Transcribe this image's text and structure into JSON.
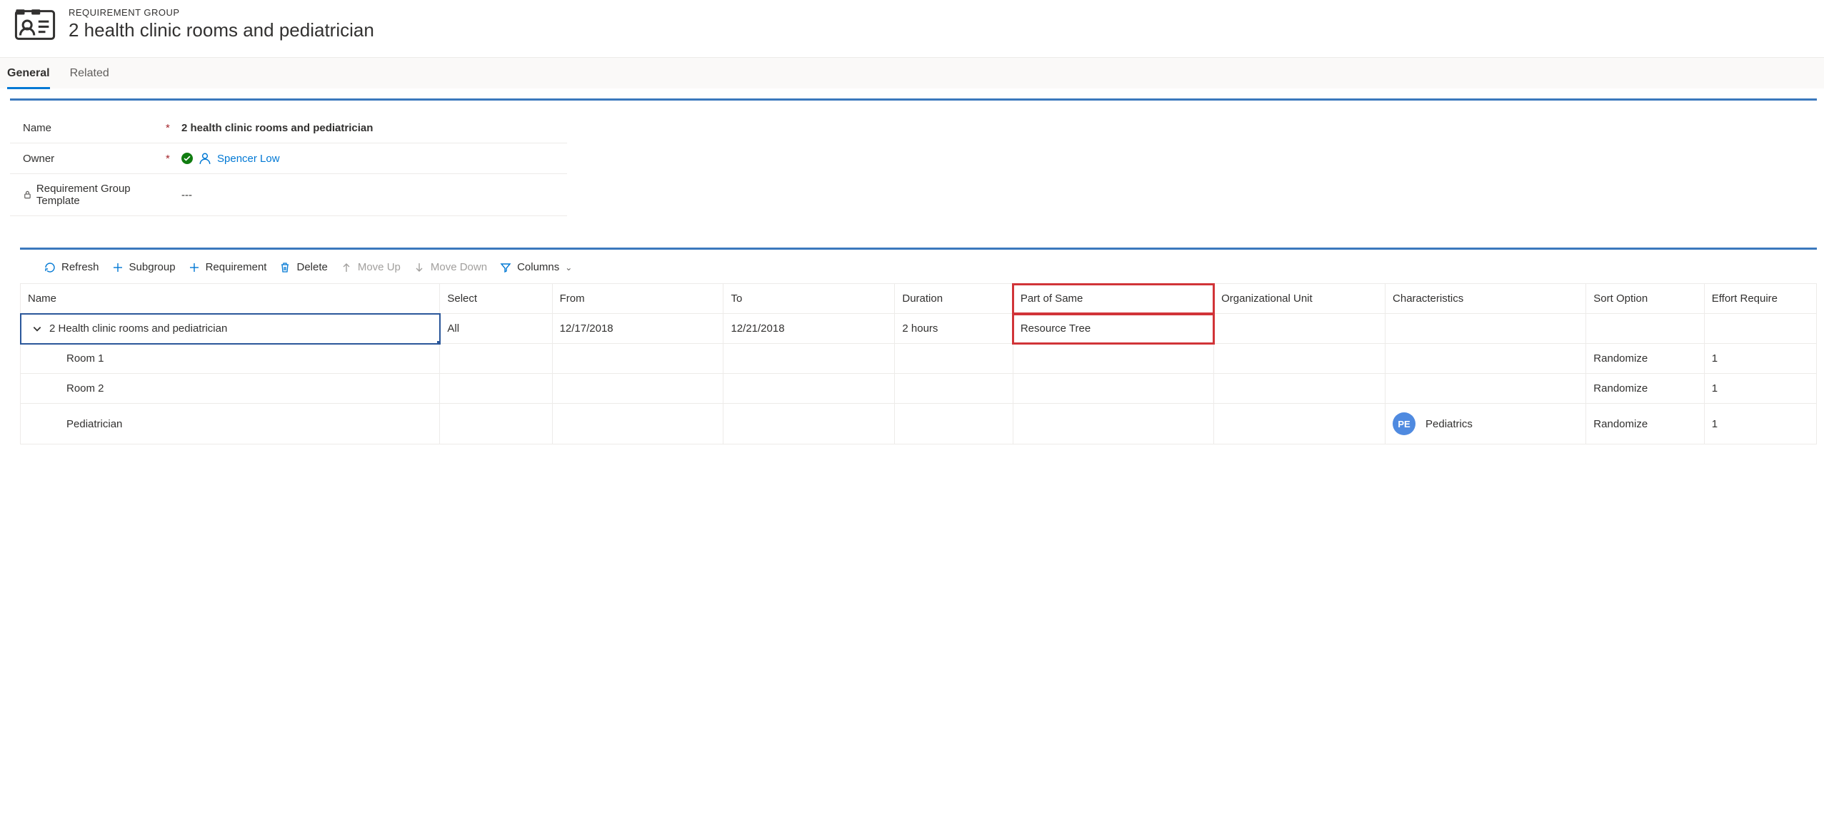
{
  "header": {
    "eyebrow": "REQUIREMENT GROUP",
    "title": "2 health clinic rooms and pediatrician"
  },
  "tabs": {
    "general": "General",
    "related": "Related"
  },
  "form": {
    "name_label": "Name",
    "name_value": "2 health clinic rooms and pediatrician",
    "owner_label": "Owner",
    "owner_value": "Spencer Low",
    "template_label": "Requirement Group Template",
    "template_value": "---"
  },
  "toolbar": {
    "refresh": "Refresh",
    "subgroup": "Subgroup",
    "requirement": "Requirement",
    "delete": "Delete",
    "moveup": "Move Up",
    "movedown": "Move Down",
    "columns": "Columns"
  },
  "grid": {
    "headers": {
      "name": "Name",
      "select": "Select",
      "from": "From",
      "to": "To",
      "duration": "Duration",
      "partofsame": "Part of Same",
      "orgunit": "Organizational Unit",
      "characteristics": "Characteristics",
      "sortoption": "Sort Option",
      "effort": "Effort Require"
    },
    "rows": [
      {
        "name": "2 Health clinic rooms and pediatrician",
        "select": "All",
        "from": "12/17/2018",
        "to": "12/21/2018",
        "duration": "2 hours",
        "partofsame": "Resource Tree",
        "orgunit": "",
        "char_text": "",
        "char_badge": "",
        "sortoption": "",
        "effort": ""
      },
      {
        "name": "Room 1",
        "select": "",
        "from": "",
        "to": "",
        "duration": "",
        "partofsame": "",
        "orgunit": "",
        "char_text": "",
        "char_badge": "",
        "sortoption": "Randomize",
        "effort": "1"
      },
      {
        "name": "Room 2",
        "select": "",
        "from": "",
        "to": "",
        "duration": "",
        "partofsame": "",
        "orgunit": "",
        "char_text": "",
        "char_badge": "",
        "sortoption": "Randomize",
        "effort": "1"
      },
      {
        "name": "Pediatrician",
        "select": "",
        "from": "",
        "to": "",
        "duration": "",
        "partofsame": "",
        "orgunit": "",
        "char_text": "Pediatrics",
        "char_badge": "PE",
        "sortoption": "Randomize",
        "effort": "1"
      }
    ]
  }
}
